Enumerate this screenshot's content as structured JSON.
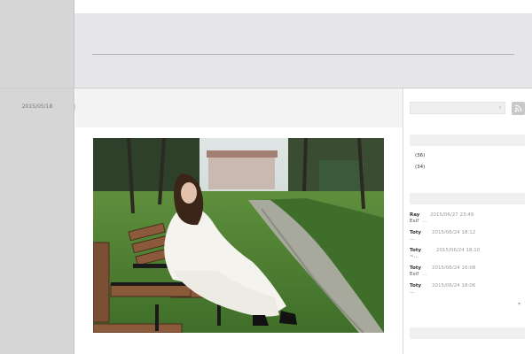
{
  "post": {
    "date": "2015/05/18"
  },
  "search": {
    "arrow": "›"
  },
  "archives": {
    "counts": [
      "(36)",
      "(34)"
    ]
  },
  "recent_comments": [
    {
      "author": "Ray",
      "time": "2015/06/27 23:49",
      "excerpt": "Exif",
      "dots": "…"
    },
    {
      "author": "Toty",
      "time": "2015/06/24 18:12",
      "excerpt": "…",
      "dots": ""
    },
    {
      "author": "Toty",
      "time": "2015/06/24 18:10",
      "excerpt": "~…",
      "dots": ""
    },
    {
      "author": "Toty",
      "time": "2015/06/24 16:08",
      "excerpt": "Exif",
      "dots": "…"
    },
    {
      "author": "Toty",
      "time": "2015/06/24 18:06",
      "excerpt": "…",
      "dots": ""
    }
  ],
  "more_chevron": "▾",
  "icons": {
    "rss": "rss-icon",
    "search_submit": "chevron-right-icon"
  },
  "colors": {
    "rail": "#d6d6d6",
    "header": "#e6e6ea",
    "rss": "#c8c8c8"
  }
}
